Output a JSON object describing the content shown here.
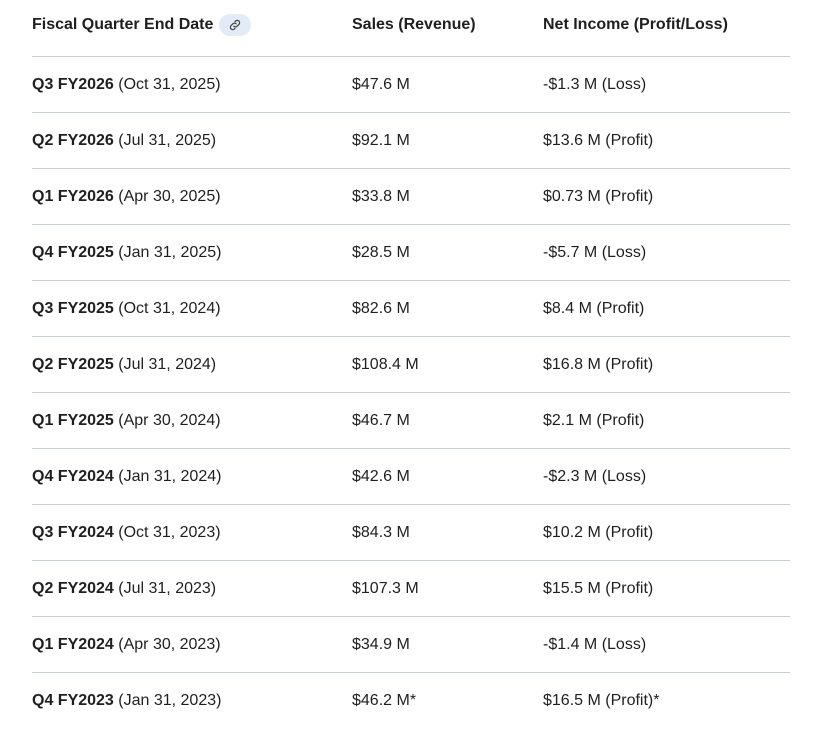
{
  "table": {
    "headers": [
      "Fiscal Quarter End Date",
      "Sales (Revenue)",
      "Net Income (Profit/Loss)"
    ],
    "link_icon": "link-icon",
    "rows": [
      {
        "quarter": "Q3 FY2026",
        "date": " (Oct 31, 2025)",
        "sales": "$47.6 M",
        "income": "-$1.3 M (Loss)"
      },
      {
        "quarter": "Q2 FY2026",
        "date": " (Jul 31, 2025)",
        "sales": "$92.1 M",
        "income": "$13.6 M (Profit)"
      },
      {
        "quarter": "Q1 FY2026",
        "date": " (Apr 30, 2025)",
        "sales": "$33.8 M",
        "income": "$0.73 M (Profit)"
      },
      {
        "quarter": "Q4 FY2025",
        "date": " (Jan 31, 2025)",
        "sales": "$28.5 M",
        "income": "-$5.7 M (Loss)"
      },
      {
        "quarter": "Q3 FY2025",
        "date": " (Oct 31, 2024)",
        "sales": "$82.6 M",
        "income": "$8.4 M (Profit)"
      },
      {
        "quarter": "Q2 FY2025",
        "date": " (Jul 31, 2024)",
        "sales": "$108.4 M",
        "income": "$16.8 M (Profit)"
      },
      {
        "quarter": "Q1 FY2025",
        "date": " (Apr 30, 2024)",
        "sales": "$46.7 M",
        "income": "$2.1 M (Profit)"
      },
      {
        "quarter": "Q4 FY2024",
        "date": " (Jan 31, 2024)",
        "sales": "$42.6 M",
        "income": "-$2.3 M (Loss)"
      },
      {
        "quarter": "Q3 FY2024",
        "date": " (Oct 31, 2023)",
        "sales": "$84.3 M",
        "income": "$10.2 M (Profit)"
      },
      {
        "quarter": "Q2 FY2024",
        "date": " (Jul 31, 2023)",
        "sales": "$107.3 M",
        "income": "$15.5 M (Profit)"
      },
      {
        "quarter": "Q1 FY2024",
        "date": " (Apr 30, 2023)",
        "sales": "$34.9 M",
        "income": "-$1.4 M (Loss)"
      },
      {
        "quarter": "Q4 FY2023",
        "date": " (Jan 31, 2023)",
        "sales": "$46.2 M*",
        "income": "$16.5 M (Profit)*"
      }
    ]
  },
  "colors": {
    "text": "#1f1f1f",
    "divider": "#c7cfd6",
    "chip_bg": "#e3ebf8",
    "chip_icon": "#444746"
  }
}
